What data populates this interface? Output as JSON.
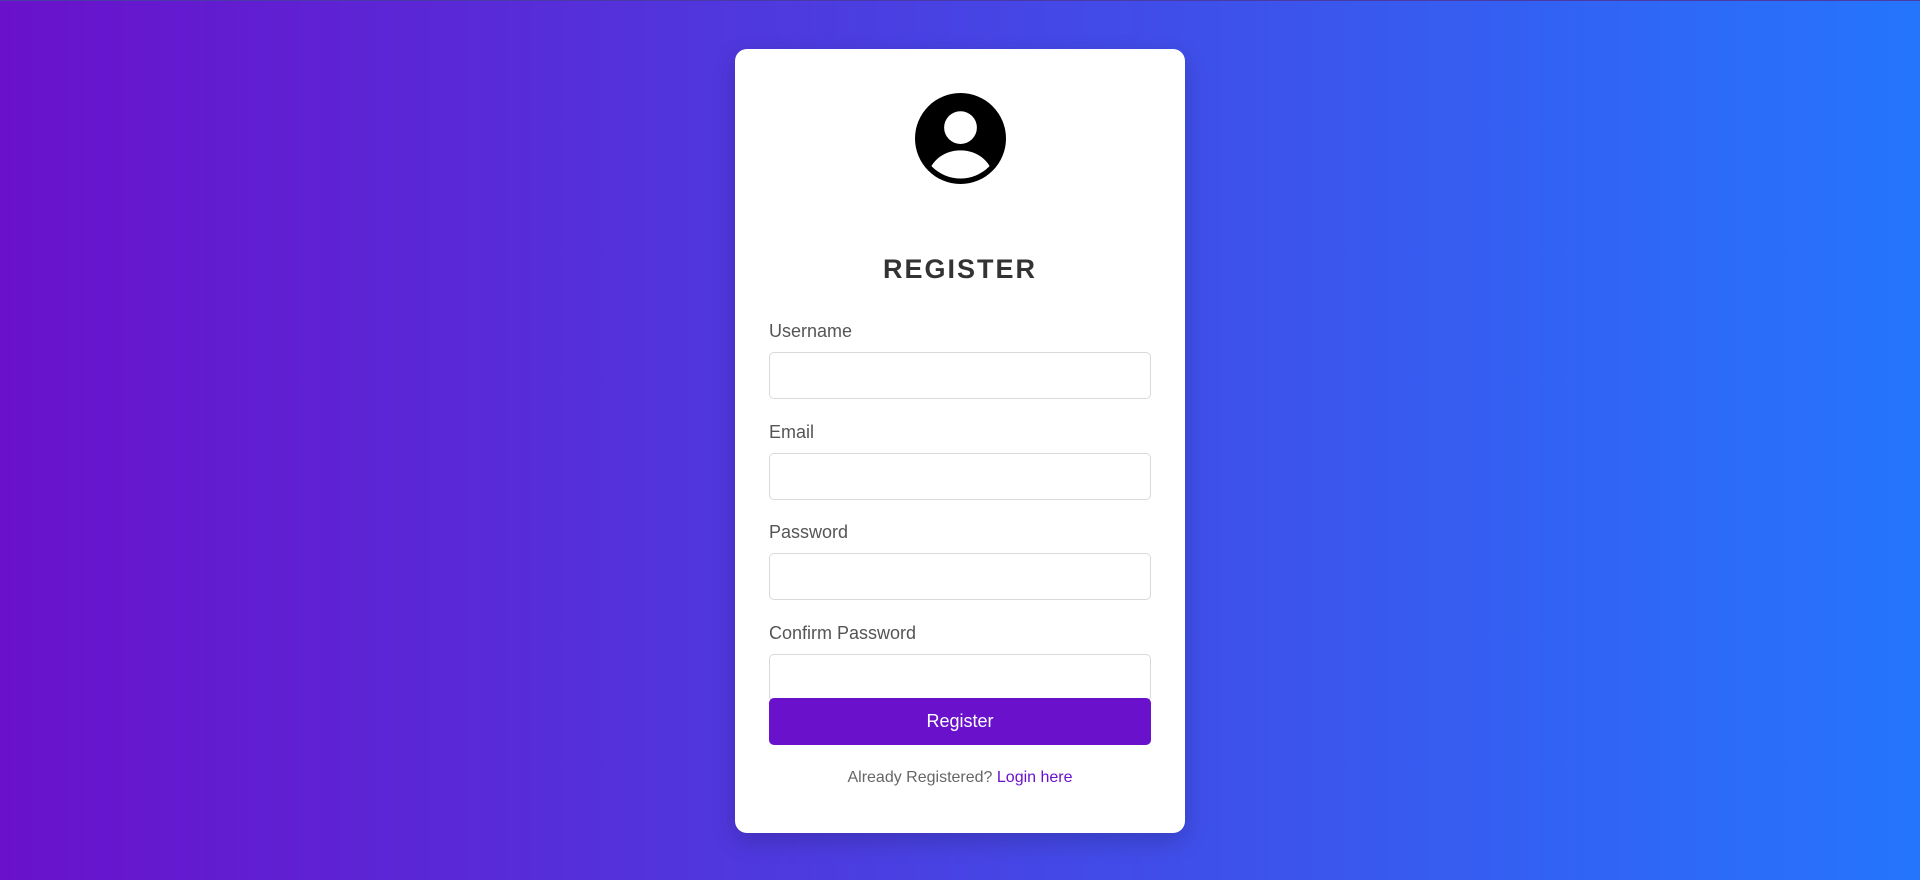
{
  "form": {
    "title": "REGISTER",
    "avatar_icon": "user-circle-icon",
    "fields": [
      {
        "label": "Username",
        "value": "",
        "placeholder": ""
      },
      {
        "label": "Email",
        "value": "",
        "placeholder": ""
      },
      {
        "label": "Password",
        "value": "",
        "placeholder": ""
      },
      {
        "label": "Confirm Password",
        "value": "",
        "placeholder": ""
      }
    ],
    "submit_label": "Register",
    "footer_text": "Already Registered?",
    "footer_link": "Login here"
  },
  "colors": {
    "gradient_start": "#6a11cb",
    "gradient_end": "#2575fc",
    "accent": "#6a11cb"
  }
}
